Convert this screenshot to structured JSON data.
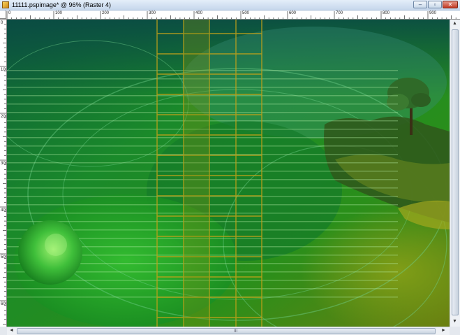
{
  "window": {
    "title": "11111.pspimage* @  96% (Raster 4)",
    "buttons": {
      "minimize": "–",
      "maximize": "▫",
      "close": "✕"
    }
  },
  "rulers": {
    "horizontal_labels": [
      "0",
      "100",
      "200",
      "300",
      "400",
      "500",
      "600",
      "700",
      "800",
      "900"
    ],
    "vertical_labels": [
      "0",
      "100",
      "200",
      "300",
      "400",
      "500",
      "600"
    ]
  },
  "scrollbars": {
    "up_arrow": "▲",
    "down_arrow": "▼",
    "left_arrow": "◄",
    "right_arrow": "►",
    "grip": "III"
  },
  "colors": {
    "canvas_green": "#1f8a1f",
    "deep_teal": "#0b5a4a",
    "grid_gold": "#b8a21a",
    "lime_sphere": "#5fd34a",
    "olive": "#6a7a12"
  }
}
